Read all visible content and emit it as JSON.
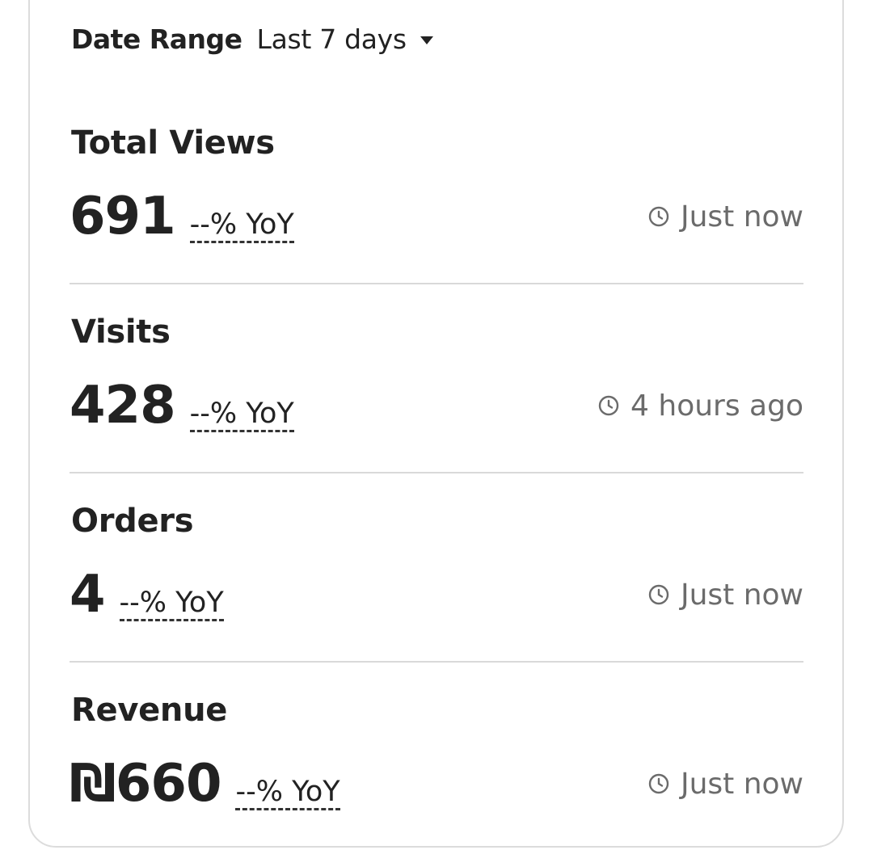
{
  "date_range": {
    "label": "Date Range",
    "value": "Last 7 days"
  },
  "metrics": [
    {
      "title": "Total Views",
      "value": "691",
      "yoy": "--% YoY",
      "updated": "Just now"
    },
    {
      "title": "Visits",
      "value": "428",
      "yoy": "--% YoY",
      "updated": "4 hours ago"
    },
    {
      "title": "Orders",
      "value": "4",
      "yoy": "--% YoY",
      "updated": "Just now"
    },
    {
      "title": "Revenue",
      "value": "₪660",
      "yoy": "--% YoY",
      "updated": "Just now"
    }
  ],
  "icons": {
    "caret": "caret-down-icon",
    "clock": "clock-icon"
  },
  "colors": {
    "text": "#222222",
    "muted": "#6b6b6b",
    "divider": "#d9d9d9",
    "border": "#dcdcdc"
  }
}
